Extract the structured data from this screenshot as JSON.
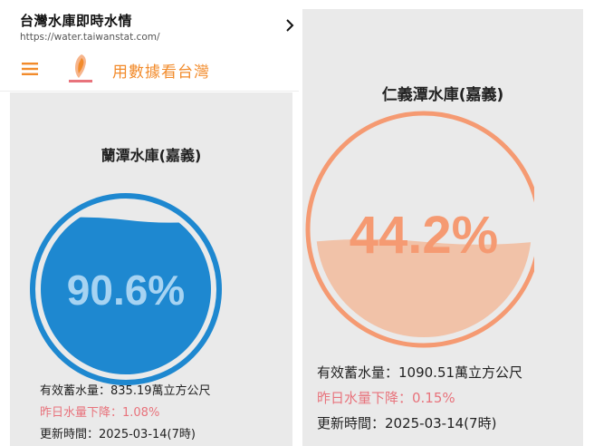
{
  "browser": {
    "title": "台灣水庫即時水情",
    "url": "https://water.taiwanstat.com/",
    "chevron_icon": "chevron-right-icon"
  },
  "site": {
    "name": "用數據看台灣",
    "menu_icon": "hamburger-menu-icon",
    "logo_icon": "taiwan-map-logo-icon",
    "accent_color": "#f28b2b"
  },
  "reservoirs": [
    {
      "name": "蘭潭水庫(嘉義)",
      "percent_label": "90.6%",
      "fill_fraction": 0.906,
      "color": "#1e88d0",
      "storage_line": "有效蓄水量：835.19萬立方公尺",
      "change_line": "昨日水量下降：1.08%",
      "updated_line": "更新時間：2025-03-14(7時)"
    },
    {
      "name": "仁義潭水庫(嘉義)",
      "percent_label": "44.2%",
      "fill_fraction": 0.442,
      "color": "#f59a72",
      "storage_line": "有效蓄水量：1090.51萬立方公尺",
      "change_line": "昨日水量下降：0.15%",
      "updated_line": "更新時間：2025-03-14(7時)"
    }
  ]
}
